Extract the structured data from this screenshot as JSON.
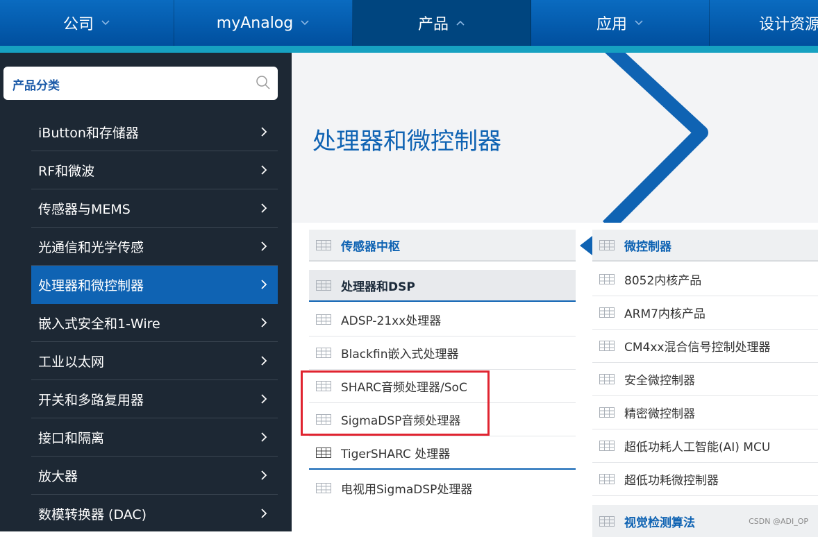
{
  "topnav": {
    "items": [
      {
        "label": "公司",
        "state": "collapsed"
      },
      {
        "label": "myAnalog",
        "state": "collapsed"
      },
      {
        "label": "产品",
        "state": "expanded"
      },
      {
        "label": "应用",
        "state": "collapsed"
      },
      {
        "label": "设计资源"
      }
    ]
  },
  "search": {
    "label": "产品分类",
    "icon": "search-icon"
  },
  "sidebar": {
    "items": [
      {
        "label": "iButton和存储器"
      },
      {
        "label": "RF和微波"
      },
      {
        "label": "传感器与MEMS"
      },
      {
        "label": "光通信和光学传感"
      },
      {
        "label": "处理器和微控制器",
        "active": true
      },
      {
        "label": "嵌入式安全和1-Wire"
      },
      {
        "label": "工业以太网"
      },
      {
        "label": "开关和多路复用器"
      },
      {
        "label": "接口和隔离"
      },
      {
        "label": "放大器"
      },
      {
        "label": "数模转换器 (DAC)"
      }
    ]
  },
  "hero": {
    "title": "处理器和微控制器"
  },
  "left_column": {
    "headers": [
      "传感器中枢",
      "处理器和DSP"
    ],
    "items": [
      "ADSP-21xx处理器",
      "Blackfin嵌入式处理器",
      "SHARC音频处理器/SoC",
      "SigmaDSP音频处理器",
      "TigerSHARC 处理器",
      "电视用SigmaDSP处理器"
    ]
  },
  "right_column": {
    "header": "微控制器",
    "items": [
      "8052内核产品",
      "ARM7内核产品",
      "CM4xx混合信号控制处理器",
      "安全微控制器",
      "精密微控制器",
      "超低功耗人工智能(AI) MCU",
      "超低功耗微控制器"
    ],
    "footer_header": "视觉检测算法"
  },
  "watermark": "CSDN @ADI_OP",
  "colors": {
    "brand_blue": "#0f63b3",
    "nav_blue": "#0a6bc0",
    "accent_teal": "#16a1c1",
    "sidebar_bg": "#1d2834",
    "highlight_red": "#e02430"
  }
}
